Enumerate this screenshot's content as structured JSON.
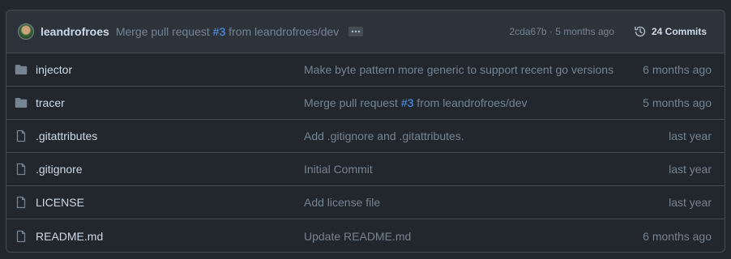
{
  "header": {
    "author": "leandrofroes",
    "commit_message_prefix": "Merge pull request ",
    "commit_message_link": "#3",
    "commit_message_suffix": " from leandrofroes/dev",
    "sha": "2cda67b",
    "sha_separator": " · ",
    "time": "5 months ago",
    "commits_label": "24 Commits"
  },
  "files": [
    {
      "type": "folder",
      "name": "injector",
      "message": "Make byte pattern more generic to support recent go versions",
      "age": "6 months ago"
    },
    {
      "type": "folder",
      "name": "tracer",
      "message_prefix": "Merge pull request ",
      "message_link": "#3",
      "message_suffix": " from leandrofroes/dev",
      "age": "5 months ago"
    },
    {
      "type": "file",
      "name": ".gitattributes",
      "message": "Add .gitignore and .gitattributes.",
      "age": "last year"
    },
    {
      "type": "file",
      "name": ".gitignore",
      "message": "Initial Commit",
      "age": "last year"
    },
    {
      "type": "file",
      "name": "LICENSE",
      "message": "Add license file",
      "age": "last year"
    },
    {
      "type": "file",
      "name": "README.md",
      "message": "Update README.md",
      "age": "6 months ago"
    }
  ],
  "colors": {
    "background": "#22272e",
    "header_background": "#2d333b",
    "border": "#444c56",
    "link": "#539bf5",
    "muted": "#768390",
    "text": "#cdd9e5"
  }
}
